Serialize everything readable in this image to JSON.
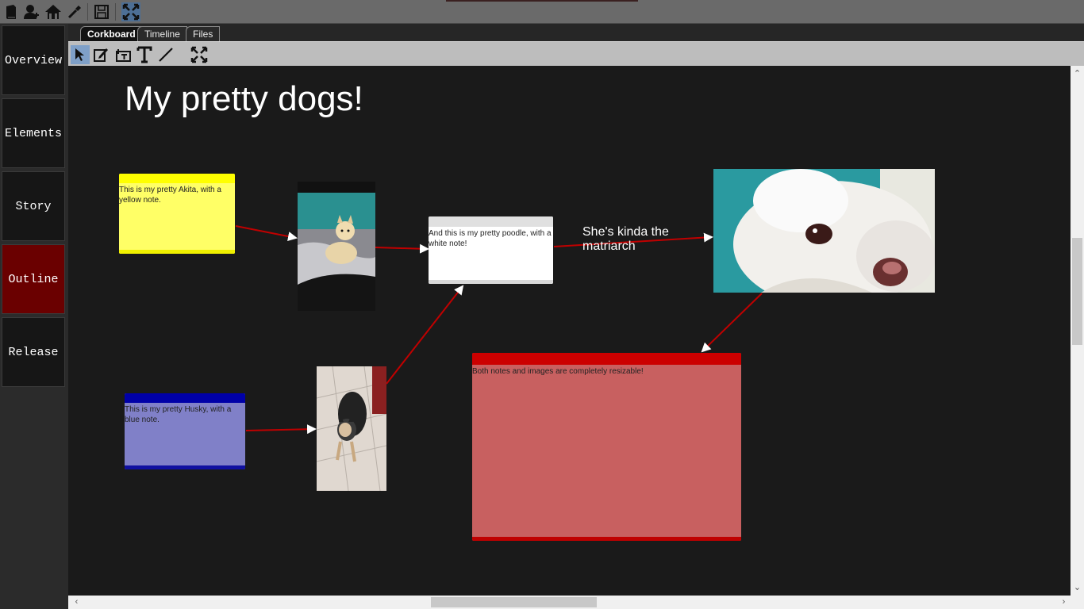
{
  "toolbar": {
    "icons": [
      "book-icon",
      "add-person-icon",
      "places-icon",
      "dropper-icon",
      "save-icon",
      "fullscreen-icon"
    ]
  },
  "sidebar": {
    "items": [
      {
        "label": "Overview"
      },
      {
        "label": "Elements"
      },
      {
        "label": "Story"
      },
      {
        "label": "Outline",
        "active": true
      },
      {
        "label": "Release"
      }
    ]
  },
  "tabs": [
    {
      "label": "Corkboard",
      "active": true
    },
    {
      "label": "Timeline"
    },
    {
      "label": "Files"
    }
  ],
  "tools": [
    "select-arrow-icon",
    "edit-note-icon",
    "add-text-box-icon",
    "text-tool-icon",
    "line-tool-icon",
    "fit-view-icon"
  ],
  "board": {
    "title": "My pretty dogs!",
    "notes": [
      {
        "text": "This is my pretty Akita, with a yellow note.",
        "color": "#ffff66"
      },
      {
        "text": "And this is my pretty poodle, with a white note!",
        "color": "#ffffff"
      },
      {
        "text": "This is my pretty Husky, with a blue note.",
        "color": "#8080c8"
      },
      {
        "text": "Both notes and images are completely resizable!",
        "color": "#c86060"
      }
    ],
    "caption": "She's kinda the matriarch",
    "link_color": "#c00000"
  },
  "colors": {
    "sidebar_active": "#6a0000",
    "canvas_bg": "#1a1a1a",
    "toolbar_bg": "#6a6a6a"
  }
}
